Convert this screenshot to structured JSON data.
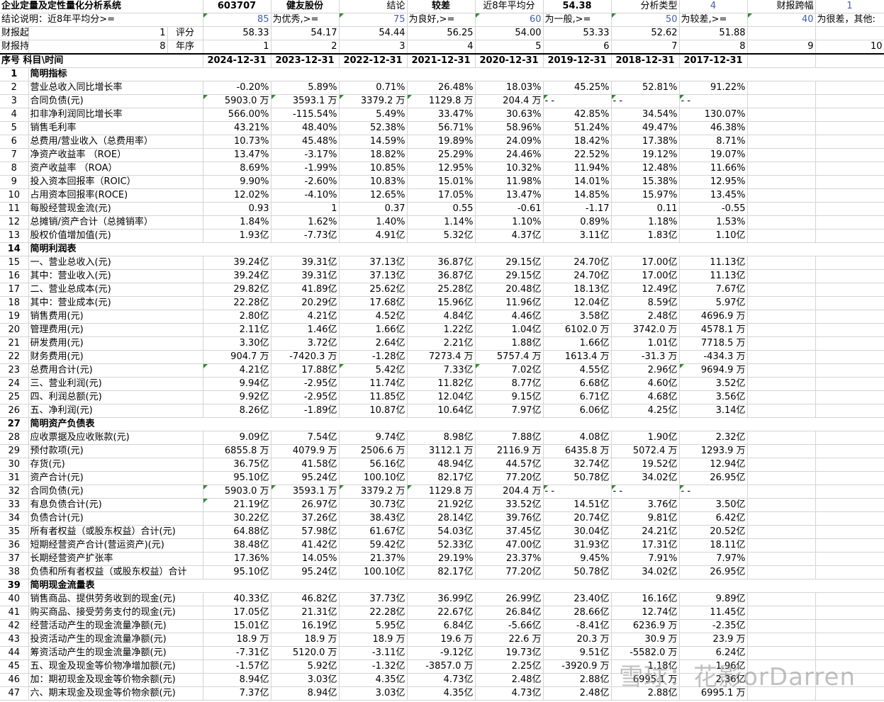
{
  "info": {
    "r1": [
      "企业定量及定性量化分析系统",
      "603707",
      "健友股份",
      "结论",
      "较差",
      "近8年平均分",
      "54.38",
      "分析类型",
      "4",
      "财报跨幅",
      "1"
    ],
    "r2": [
      "结论说明：近8年平均分>=",
      "85",
      "为优秀,>=",
      "75",
      "为良好,>=",
      "60",
      "为一般,>=",
      "50",
      "为较差,>=",
      "40",
      "为很差，其他:"
    ],
    "r3": [
      "财报起始年数",
      "1",
      "评分",
      "58.33",
      "54.17",
      "54.44",
      "56.25",
      "54.00",
      "53.33",
      "52.62",
      "51.88"
    ],
    "r4": [
      "财报持续年数",
      "8",
      "年序",
      "1",
      "2",
      "3",
      "4",
      "5",
      "6",
      "7",
      "8",
      "9",
      "10"
    ]
  },
  "header": {
    "seq": "序号",
    "item": "科目\\时间",
    "dates": [
      "2024-12-31",
      "2023-12-31",
      "2022-12-31",
      "2021-12-31",
      "2020-12-31",
      "2019-12-31",
      "2018-12-31",
      "2017-12-31"
    ]
  },
  "rows": [
    {
      "n": "1",
      "label": "简明指标",
      "section": true
    },
    {
      "n": "2",
      "label": "营业总收入同比增长率",
      "v": [
        "-0.20%",
        "5.89%",
        "0.71%",
        "26.48%",
        "18.03%",
        "45.25%",
        "52.81%",
        "91.22%"
      ]
    },
    {
      "n": "3",
      "label": "合同负债(元)",
      "v": [
        "5903.0 万",
        "3593.1 万",
        "3379.2 万",
        "1129.8 万",
        "204.4 万",
        "- -",
        "- -",
        "- -"
      ]
    },
    {
      "n": "4",
      "label": "扣非净利润同比增长率",
      "v": [
        "566.00%",
        "-115.54%",
        "5.49%",
        "33.47%",
        "30.63%",
        "42.85%",
        "34.54%",
        "130.07%"
      ]
    },
    {
      "n": "5",
      "label": "销售毛利率",
      "v": [
        "43.21%",
        "48.40%",
        "52.38%",
        "56.71%",
        "58.96%",
        "51.24%",
        "49.47%",
        "46.38%"
      ]
    },
    {
      "n": "6",
      "label": "总费用/营业收入（总费用率）",
      "v": [
        "10.73%",
        "45.48%",
        "14.59%",
        "19.89%",
        "24.09%",
        "18.42%",
        "17.38%",
        "8.71%"
      ]
    },
    {
      "n": "7",
      "label": "净资产收益率 （ROE）",
      "v": [
        "13.47%",
        "-3.17%",
        "18.82%",
        "25.29%",
        "24.46%",
        "22.52%",
        "19.12%",
        "19.07%"
      ]
    },
    {
      "n": "8",
      "label": "资产收益率 （ROA）",
      "v": [
        "8.69%",
        "-1.99%",
        "10.85%",
        "12.95%",
        "10.32%",
        "11.94%",
        "12.48%",
        "11.66%"
      ]
    },
    {
      "n": "9",
      "label": "投入资本回报率（ROIC）",
      "v": [
        "9.90%",
        "-2.60%",
        "10.83%",
        "15.01%",
        "11.98%",
        "14.01%",
        "15.38%",
        "12.95%"
      ]
    },
    {
      "n": "10",
      "label": "占用资本回报率(ROCE)",
      "v": [
        "12.02%",
        "-4.10%",
        "12.65%",
        "17.05%",
        "13.47%",
        "14.85%",
        "15.97%",
        "13.45%"
      ]
    },
    {
      "n": "11",
      "label": "每股经营现金流(元)",
      "v": [
        "0.93",
        "1",
        "0.37",
        "0.55",
        "-0.61",
        "-1.17",
        "0.11",
        "-0.55"
      ]
    },
    {
      "n": "12",
      "label": "总摊销/资产合计（总摊销率）",
      "v": [
        "1.84%",
        "1.62%",
        "1.40%",
        "1.14%",
        "1.10%",
        "0.89%",
        "1.18%",
        "1.53%"
      ]
    },
    {
      "n": "13",
      "label": "股权价值增加值(元)",
      "v": [
        "1.93亿",
        "-7.73亿",
        "4.91亿",
        "5.32亿",
        "4.37亿",
        "3.11亿",
        "1.83亿",
        "1.10亿"
      ]
    },
    {
      "n": "14",
      "label": "简明利润表",
      "section": true
    },
    {
      "n": "15",
      "label": "一、营业总收入(元)",
      "v": [
        "39.24亿",
        "39.31亿",
        "37.13亿",
        "36.87亿",
        "29.15亿",
        "24.70亿",
        "17.00亿",
        "11.13亿"
      ]
    },
    {
      "n": "16",
      "label": "其中：营业收入(元)",
      "v": [
        "39.24亿",
        "39.31亿",
        "37.13亿",
        "36.87亿",
        "29.15亿",
        "24.70亿",
        "17.00亿",
        "11.13亿"
      ]
    },
    {
      "n": "17",
      "label": "二、营业总成本(元)",
      "v": [
        "29.82亿",
        "41.89亿",
        "25.62亿",
        "25.28亿",
        "20.48亿",
        "18.13亿",
        "12.49亿",
        "7.67亿"
      ]
    },
    {
      "n": "18",
      "label": "其中：营业成本(元)",
      "v": [
        "22.28亿",
        "20.29亿",
        "17.68亿",
        "15.96亿",
        "11.96亿",
        "12.04亿",
        "8.59亿",
        "5.97亿"
      ]
    },
    {
      "n": "19",
      "label": "销售费用(元)",
      "v": [
        "2.80亿",
        "4.21亿",
        "4.52亿",
        "4.84亿",
        "4.46亿",
        "3.58亿",
        "2.48亿",
        "4696.9 万"
      ]
    },
    {
      "n": "20",
      "label": "管理费用(元)",
      "v": [
        "2.11亿",
        "1.46亿",
        "1.66亿",
        "1.22亿",
        "1.04亿",
        "6102.0 万",
        "3742.0 万",
        "4578.1 万"
      ]
    },
    {
      "n": "21",
      "label": "研发费用(元)",
      "v": [
        "3.30亿",
        "3.72亿",
        "2.64亿",
        "2.21亿",
        "1.88亿",
        "1.66亿",
        "1.01亿",
        "7718.5 万"
      ]
    },
    {
      "n": "22",
      "label": "财务费用(元)",
      "v": [
        "904.7 万",
        "-7420.3 万",
        "-1.28亿",
        "7273.4 万",
        "5757.4 万",
        "1613.4 万",
        "-31.3 万",
        "-434.3 万"
      ]
    },
    {
      "n": "23",
      "label": "总费用合计(元)",
      "v": [
        "4.21亿",
        "17.88亿",
        "5.42亿",
        "7.33亿",
        "7.02亿",
        "4.55亿",
        "2.96亿",
        "9694.9 万"
      ]
    },
    {
      "n": "24",
      "label": "三、营业利润(元)",
      "v": [
        "9.94亿",
        "-2.95亿",
        "11.74亿",
        "11.82亿",
        "8.77亿",
        "6.68亿",
        "4.60亿",
        "3.52亿"
      ]
    },
    {
      "n": "25",
      "label": "四、利润总额(元)",
      "v": [
        "9.92亿",
        "-2.95亿",
        "11.85亿",
        "12.04亿",
        "9.15亿",
        "6.71亿",
        "4.68亿",
        "3.56亿"
      ]
    },
    {
      "n": "26",
      "label": "五、净利润(元)",
      "v": [
        "8.26亿",
        "-1.89亿",
        "10.87亿",
        "10.64亿",
        "7.97亿",
        "6.06亿",
        "4.25亿",
        "3.14亿"
      ]
    },
    {
      "n": "27",
      "label": "简明资产负债表",
      "section": true
    },
    {
      "n": "28",
      "label": "应收票据及应收账款(元)",
      "v": [
        "9.09亿",
        "7.54亿",
        "9.74亿",
        "8.98亿",
        "7.88亿",
        "4.08亿",
        "1.90亿",
        "2.32亿"
      ]
    },
    {
      "n": "29",
      "label": "预付款项(元)",
      "v": [
        "6855.8 万",
        "4079.9 万",
        "2506.6 万",
        "3112.1 万",
        "2116.9 万",
        "6435.8 万",
        "5072.4 万",
        "1293.9 万"
      ]
    },
    {
      "n": "30",
      "label": "存货(元)",
      "v": [
        "36.75亿",
        "41.58亿",
        "56.16亿",
        "48.94亿",
        "44.57亿",
        "32.74亿",
        "19.52亿",
        "12.94亿"
      ]
    },
    {
      "n": "31",
      "label": "资产合计(元)",
      "v": [
        "95.10亿",
        "95.24亿",
        "100.10亿",
        "82.17亿",
        "77.20亿",
        "50.78亿",
        "34.02亿",
        "26.95亿"
      ]
    },
    {
      "n": "32",
      "label": "合同负债(元)",
      "v": [
        "5903.0 万",
        "3593.1 万",
        "3379.2 万",
        "1129.8 万",
        "204.4 万",
        "- -",
        "- -",
        "- -"
      ]
    },
    {
      "n": "33",
      "label": "有息负债合计(元)",
      "v": [
        "21.19亿",
        "26.97亿",
        "30.73亿",
        "21.92亿",
        "33.52亿",
        "14.51亿",
        "3.76亿",
        "3.50亿"
      ]
    },
    {
      "n": "34",
      "label": "负债合计(元)",
      "v": [
        "30.22亿",
        "37.26亿",
        "38.43亿",
        "28.14亿",
        "39.76亿",
        "20.74亿",
        "9.81亿",
        "6.42亿"
      ]
    },
    {
      "n": "35",
      "label": "所有者权益（或股东权益）合计(元)",
      "v": [
        "64.88亿",
        "57.98亿",
        "61.67亿",
        "54.03亿",
        "37.45亿",
        "30.04亿",
        "24.21亿",
        "20.52亿"
      ]
    },
    {
      "n": "36",
      "label": "短期经营资产合计(营运资产)(元)",
      "v": [
        "38.48亿",
        "41.42亿",
        "59.42亿",
        "52.33亿",
        "47.00亿",
        "31.93亿",
        "17.31亿",
        "18.11亿"
      ]
    },
    {
      "n": "37",
      "label": "长期经营资产扩张率",
      "v": [
        "17.36%",
        "14.05%",
        "21.37%",
        "29.19%",
        "23.37%",
        "9.45%",
        "7.91%",
        "7.97%"
      ]
    },
    {
      "n": "38",
      "label": "负债和所有者权益（或股东权益）合计",
      "v": [
        "95.10亿",
        "95.24亿",
        "100.10亿",
        "82.17亿",
        "77.20亿",
        "50.78亿",
        "34.02亿",
        "26.95亿"
      ]
    },
    {
      "n": "39",
      "label": "简明现金流量表",
      "section": true
    },
    {
      "n": "40",
      "label": "销售商品、提供劳务收到的现金(元)",
      "v": [
        "40.33亿",
        "46.82亿",
        "37.73亿",
        "36.99亿",
        "26.99亿",
        "23.40亿",
        "16.16亿",
        "9.89亿"
      ]
    },
    {
      "n": "41",
      "label": "购买商品、接受劳务支付的现金(元)",
      "v": [
        "17.05亿",
        "21.31亿",
        "22.28亿",
        "22.67亿",
        "26.84亿",
        "28.66亿",
        "12.74亿",
        "11.45亿"
      ]
    },
    {
      "n": "42",
      "label": "经营活动产生的现金流量净额(元)",
      "v": [
        "15.01亿",
        "16.19亿",
        "5.95亿",
        "6.84亿",
        "-5.66亿",
        "-8.41亿",
        "6236.9 万",
        "-2.35亿"
      ]
    },
    {
      "n": "43",
      "label": "投资活动产生的现金流量净额(元)",
      "v": [
        "18.9 万",
        "18.9 万",
        "18.9 万",
        "19.6 万",
        "22.6 万",
        "20.3 万",
        "30.9 万",
        "23.9 万"
      ]
    },
    {
      "n": "44",
      "label": "筹资活动产生的现金流量净额(元)",
      "v": [
        "-7.31亿",
        "5120.0 万",
        "-3.11亿",
        "-9.12亿",
        "19.73亿",
        "9.51亿",
        "-5582.0 万",
        "6.24亿"
      ]
    },
    {
      "n": "45",
      "label": "五、现金及现金等价物净增加额(元)",
      "v": [
        "-1.57亿",
        "5.92亿",
        "-1.32亿",
        "-3857.0 万",
        "2.25亿",
        "-3920.9 万",
        "1.18亿",
        "1.96亿"
      ]
    },
    {
      "n": "46",
      "label": "加：期初现金及现金等价物余额(元)",
      "v": [
        "8.94亿",
        "3.03亿",
        "4.35亿",
        "4.73亿",
        "2.48亿",
        "2.88亿",
        "6995.1 万",
        "2.36亿"
      ]
    },
    {
      "n": "47",
      "label": "六、期末现金及现金等价物余额(元)",
      "v": [
        "7.37亿",
        "8.94亿",
        "3.03亿",
        "4.35亿",
        "4.73亿",
        "2.48亿",
        "2.88亿",
        "6995.1 万"
      ]
    }
  ],
  "flags": {
    "3": [
      1,
      1,
      1,
      1,
      0,
      1,
      1,
      1
    ],
    "32": [
      1,
      1,
      1,
      1,
      0,
      1,
      1,
      1
    ],
    "23": [
      1,
      0,
      1,
      0,
      1,
      0,
      0,
      1
    ],
    "33": [
      1,
      0,
      0,
      0,
      0,
      0,
      0,
      0
    ]
  },
  "watermark": "雪球：花影orDarren"
}
